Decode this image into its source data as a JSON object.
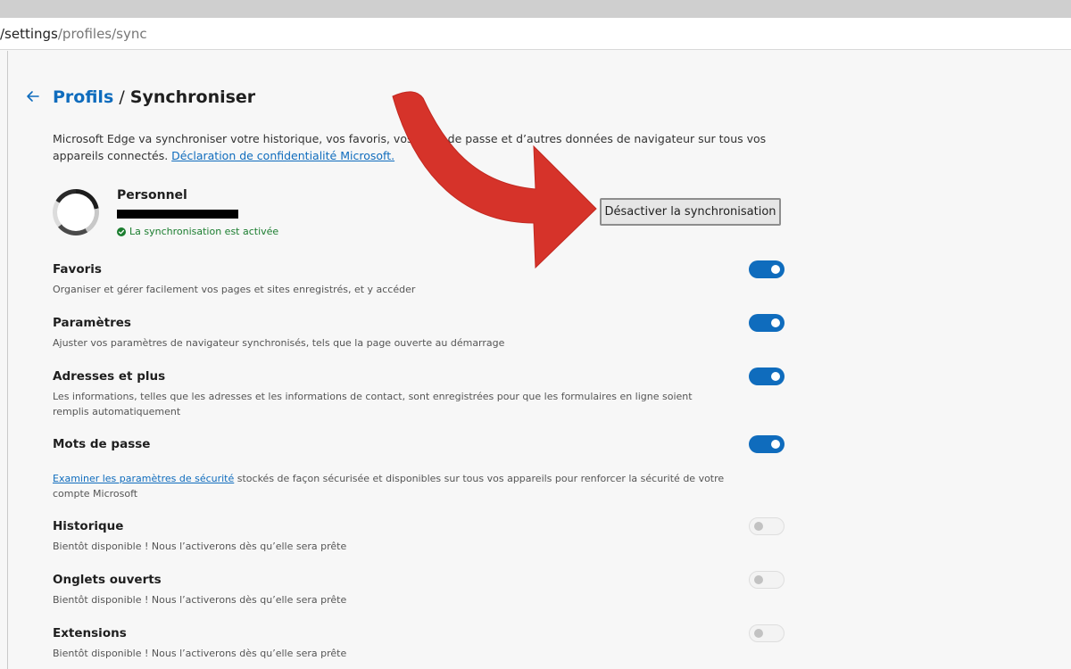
{
  "address_bar": {
    "url_prefix": "/settings",
    "url_suffix": "/profiles/sync"
  },
  "breadcrumb": {
    "parent": "Profils",
    "separator": "/",
    "current": "Synchroniser"
  },
  "intro": {
    "text": "Microsoft Edge va synchroniser votre historique, vos favoris, vos mots de passe et d’autres données de navigateur sur tous vos appareils connectés.",
    "link": "Déclaration de confidentialité Microsoft."
  },
  "profile": {
    "name": "Personnel",
    "sync_status": "La synchronisation est activée"
  },
  "disable_button": {
    "label": "Désactiver la synchronisation"
  },
  "settings": [
    {
      "title": "Favoris",
      "description": "Organiser et gérer facilement vos pages et sites enregistrés, et y accéder",
      "enabled": true
    },
    {
      "title": "Paramètres",
      "description": "Ajuster vos paramètres de navigateur synchronisés, tels que la page ouverte au démarrage",
      "enabled": true
    },
    {
      "title": "Adresses et plus",
      "description": "Les informations, telles que les adresses et les informations de contact, sont enregistrées pour que les formulaires en ligne soient remplis automatiquement",
      "enabled": true
    },
    {
      "title": "Mots de passe",
      "description_link": "Examiner les paramètres de sécurité",
      "description": " stockés de façon sécurisée et disponibles sur tous vos appareils pour renforcer la sécurité de votre compte Microsoft",
      "enabled": true
    },
    {
      "title": "Historique",
      "description": "Bientôt disponible ! Nous l’activerons dès qu’elle sera prête",
      "enabled": false
    },
    {
      "title": "Onglets ouverts",
      "description": "Bientôt disponible ! Nous l’activerons dès qu’elle sera prête",
      "enabled": false
    },
    {
      "title": "Extensions",
      "description": "Bientôt disponible ! Nous l’activerons dès qu’elle sera prête",
      "enabled": false
    }
  ],
  "colors": {
    "accent": "#0f6cbd",
    "sync_ok": "#1b7d2f",
    "annotation_arrow": "#d6332a"
  }
}
